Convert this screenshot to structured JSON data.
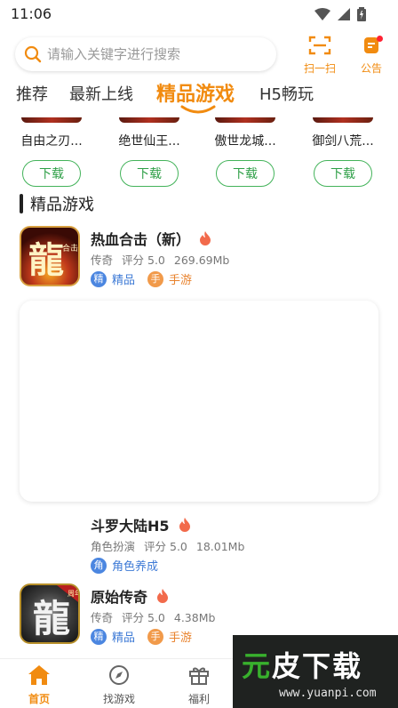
{
  "status": {
    "time": "11:06"
  },
  "search": {
    "placeholder": "请输入关键字进行搜索"
  },
  "header_actions": {
    "scan_label": "扫一扫",
    "notice_label": "公告"
  },
  "tabs": [
    {
      "label": "推荐",
      "active": false
    },
    {
      "label": "最新上线",
      "active": false
    },
    {
      "label": "精品游戏",
      "active": true
    },
    {
      "label": "H5畅玩",
      "active": false
    }
  ],
  "featured_strip": [
    {
      "name": "自由之刃...",
      "button": "下载"
    },
    {
      "name": "绝世仙王...",
      "button": "下载"
    },
    {
      "name": "傲世龙城...",
      "button": "下载"
    },
    {
      "name": "御剑八荒...",
      "button": "下载"
    }
  ],
  "section_title": "精品游戏",
  "games": [
    {
      "title": "热血合击（新）",
      "genre": "传奇",
      "rating": "评分 5.0",
      "size": "269.69Mb",
      "tags": [
        {
          "badge": "精",
          "text": "精品",
          "color": "blue"
        },
        {
          "badge": "手",
          "text": "手游",
          "color": "orange"
        }
      ]
    },
    {
      "title": "斗罗大陆H5",
      "genre": "角色扮演",
      "rating": "评分 5.0",
      "size": "18.01Mb",
      "tags": [
        {
          "badge": "角",
          "text": "角色养成",
          "color": "blue"
        }
      ]
    },
    {
      "title": "原始传奇",
      "genre": "传奇",
      "rating": "评分 5.0",
      "size": "4.38Mb",
      "tags": [
        {
          "badge": "精",
          "text": "精品",
          "color": "blue"
        },
        {
          "badge": "手",
          "text": "手游",
          "color": "orange"
        }
      ]
    }
  ],
  "icon_text": {
    "game1_char": "龍",
    "game1_small": "合击",
    "game3_char": "龍",
    "game3_corner": "周年"
  },
  "bottom_nav": [
    {
      "label": "首页",
      "active": true
    },
    {
      "label": "找游戏",
      "active": false
    },
    {
      "label": "福利",
      "active": false
    }
  ],
  "watermark": {
    "title_green": "元",
    "title_white": "皮",
    "title_rest": "下载",
    "url": "www.yuanpi.com"
  },
  "colors": {
    "accent": "#f18b10",
    "download_green": "#43b35a",
    "tag_blue": "#4b86e0",
    "tag_orange": "#f19a4a"
  }
}
